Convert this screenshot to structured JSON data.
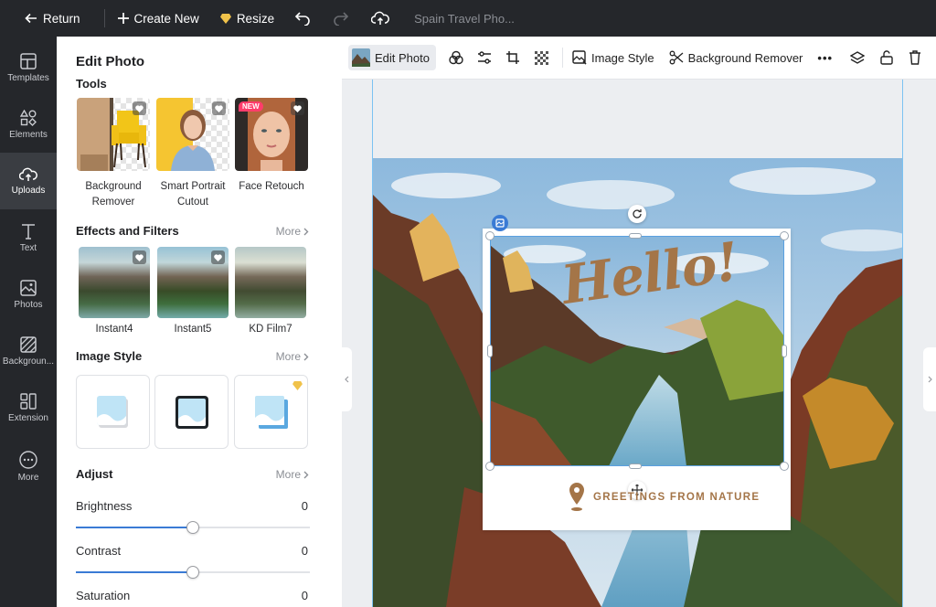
{
  "topbar": {
    "return_label": "Return",
    "create_label": "Create New",
    "resize_label": "Resize",
    "doc_title": "Spain Travel Pho..."
  },
  "rail": {
    "items": [
      {
        "label": "Templates",
        "icon": "templates-icon"
      },
      {
        "label": "Elements",
        "icon": "elements-icon"
      },
      {
        "label": "Uploads",
        "icon": "uploads-icon"
      },
      {
        "label": "Text",
        "icon": "text-icon"
      },
      {
        "label": "Photos",
        "icon": "photos-icon"
      },
      {
        "label": "Backgroun...",
        "icon": "background-icon"
      },
      {
        "label": "Extension",
        "icon": "extension-icon"
      },
      {
        "label": "More",
        "icon": "more-icon"
      }
    ]
  },
  "panel": {
    "title": "Edit Photo",
    "tools": {
      "heading": "Tools",
      "items": [
        {
          "label_line1": "Background",
          "label_line2": "Remover"
        },
        {
          "label_line1": "Smart Portrait",
          "label_line2": "Cutout"
        },
        {
          "label_line1": "Face Retouch",
          "label_line2": "",
          "badge": "NEW"
        }
      ]
    },
    "effects": {
      "heading": "Effects and Filters",
      "more": "More",
      "items": [
        {
          "label": "Instant4"
        },
        {
          "label": "Instant5"
        },
        {
          "label": "KD Film7"
        }
      ]
    },
    "image_style": {
      "heading": "Image Style",
      "more": "More"
    },
    "adjust": {
      "heading": "Adjust",
      "more": "More",
      "rows": [
        {
          "label": "Brightness",
          "value": "0",
          "fraction": 0.5
        },
        {
          "label": "Contrast",
          "value": "0",
          "fraction": 0.5
        },
        {
          "label": "Saturation",
          "value": "0",
          "fraction": 0.5
        }
      ]
    }
  },
  "toolbar": {
    "edit_photo": "Edit Photo",
    "image_style": "Image Style",
    "background_remover": "Background Remover",
    "more": "•••"
  },
  "canvas": {
    "hello_text": "Hello!",
    "greeting_text": "GREETINGS FROM NATURE"
  },
  "colors": {
    "accent": "#3a7bd5",
    "dark": "#25272b",
    "brand_brown": "#a47548",
    "new_badge": "#ff3d6b",
    "premium_gold": "#f0c24a"
  }
}
